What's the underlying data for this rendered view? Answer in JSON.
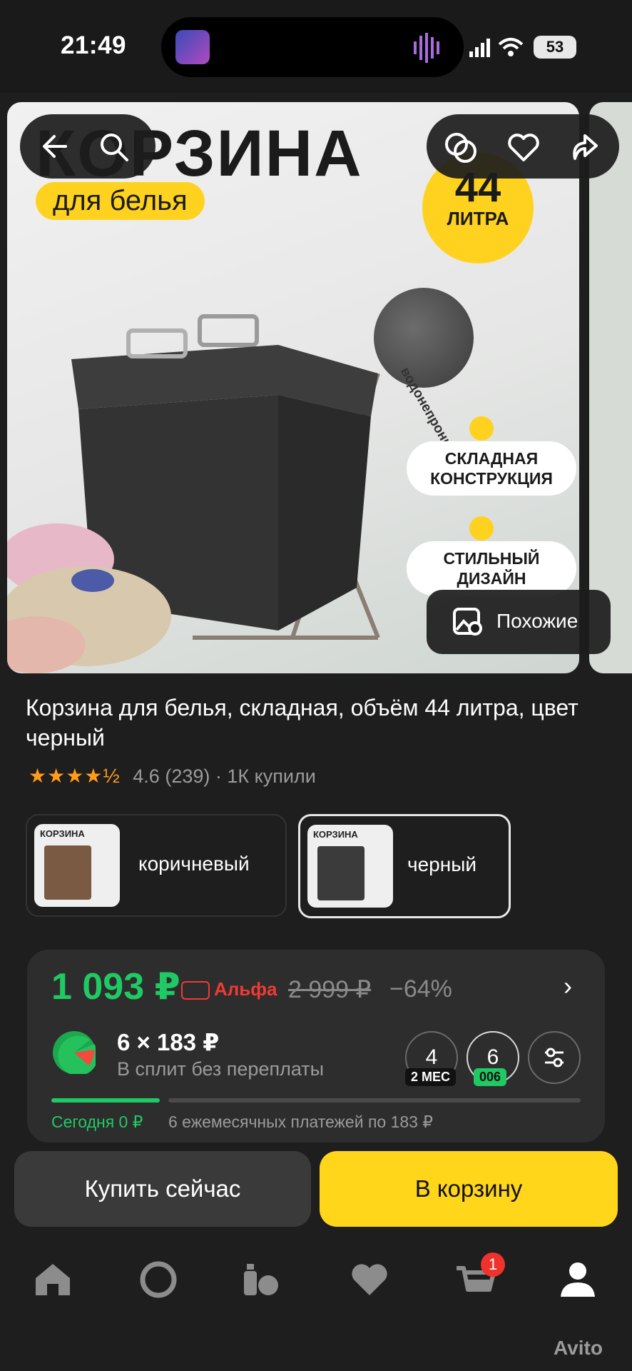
{
  "status_bar": {
    "time": "21:49",
    "battery": "53"
  },
  "gallery": {
    "image": {
      "title": "КОРЗИНА",
      "tag": "для белья",
      "liters_number": "44",
      "liters_unit": "ЛИТРА",
      "waterproof": "водонепроницаемая",
      "feature1": "СКЛАДНАЯ КОНСТРУКЦИЯ",
      "feature2": "СТИЛЬНЫЙ ДИЗАЙН"
    },
    "similar_label": "Похожие"
  },
  "product": {
    "title": "Корзина для белья, складная, объём 44 литра, цвет черный",
    "stars": "★★★★½",
    "rating": "4.6",
    "reviews": "(239)",
    "bought": "· 1К купили"
  },
  "variants": [
    {
      "label": "коричневый",
      "thumb_title": "КОРЗИНА",
      "color": "#7a5a42"
    },
    {
      "label": "черный",
      "thumb_title": "КОРЗИНА",
      "color": "#3b3b3b"
    }
  ],
  "price": {
    "current": "1 093 ₽",
    "bank": "Альфа",
    "old": "2 999 ₽",
    "discount": "−64%",
    "split_main": "6 × 183 ₽",
    "split_sub": "В сплит без переплаты",
    "option_4": "4",
    "option_4_sub": "2 МЕС",
    "option_6": "6",
    "option_6_sub": "006",
    "today": "Сегодня 0 ₽",
    "monthly": "6 ежемесячных платежей по 183 ₽",
    "progress_fraction": 0.21
  },
  "buttons": {
    "buy_now": "Купить сейчас",
    "add_to_cart": "В корзину"
  },
  "bottom_nav": {
    "items": [
      "home-icon",
      "alice-icon",
      "catalog-icon",
      "favorites-icon",
      "cart-icon",
      "profile-icon"
    ],
    "cart_badge": "1",
    "watermark": "Avito"
  },
  "colors": {
    "accent_yellow": "#ffd61a",
    "accent_green": "#20c964",
    "bg": "#1e1e1e"
  }
}
